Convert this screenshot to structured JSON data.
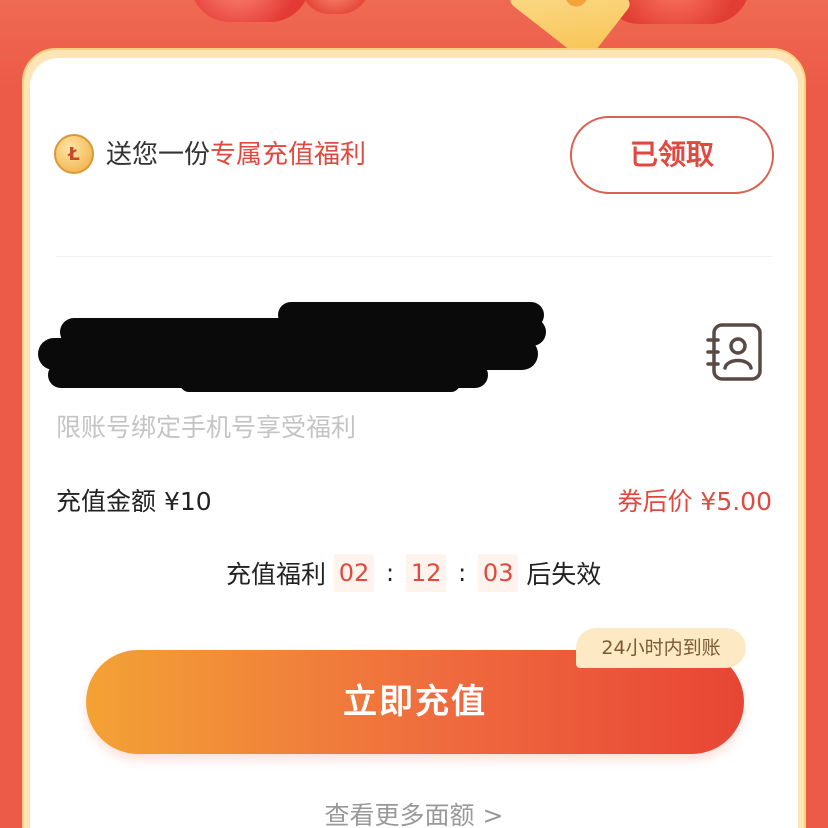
{
  "welfare": {
    "prefix": "送您一份",
    "highlight": "专属充值福利",
    "claimed_label": "已领取"
  },
  "account": {
    "hint": "限账号绑定手机号享受福利"
  },
  "price": {
    "amount_label": "充值金额 ¥10",
    "after_coupon_label": "券后价 ¥5.00"
  },
  "countdown": {
    "lead": "充值福利",
    "hours": "02",
    "minutes": "12",
    "seconds": "03",
    "separator": ":",
    "tail": "后失效"
  },
  "recharge": {
    "button_label": "立即充值",
    "badge": "24小时内到账"
  },
  "more": {
    "label": "查看更多面额 >"
  },
  "icons": {
    "gift": "coupon-coin-icon",
    "contact": "contact-book-icon"
  },
  "colors": {
    "accent": "#e0493f",
    "page_background": "#ec5a48",
    "frame": "#fde6b6",
    "button_gradient_start": "#f3a235",
    "button_gradient_end": "#e84535"
  }
}
